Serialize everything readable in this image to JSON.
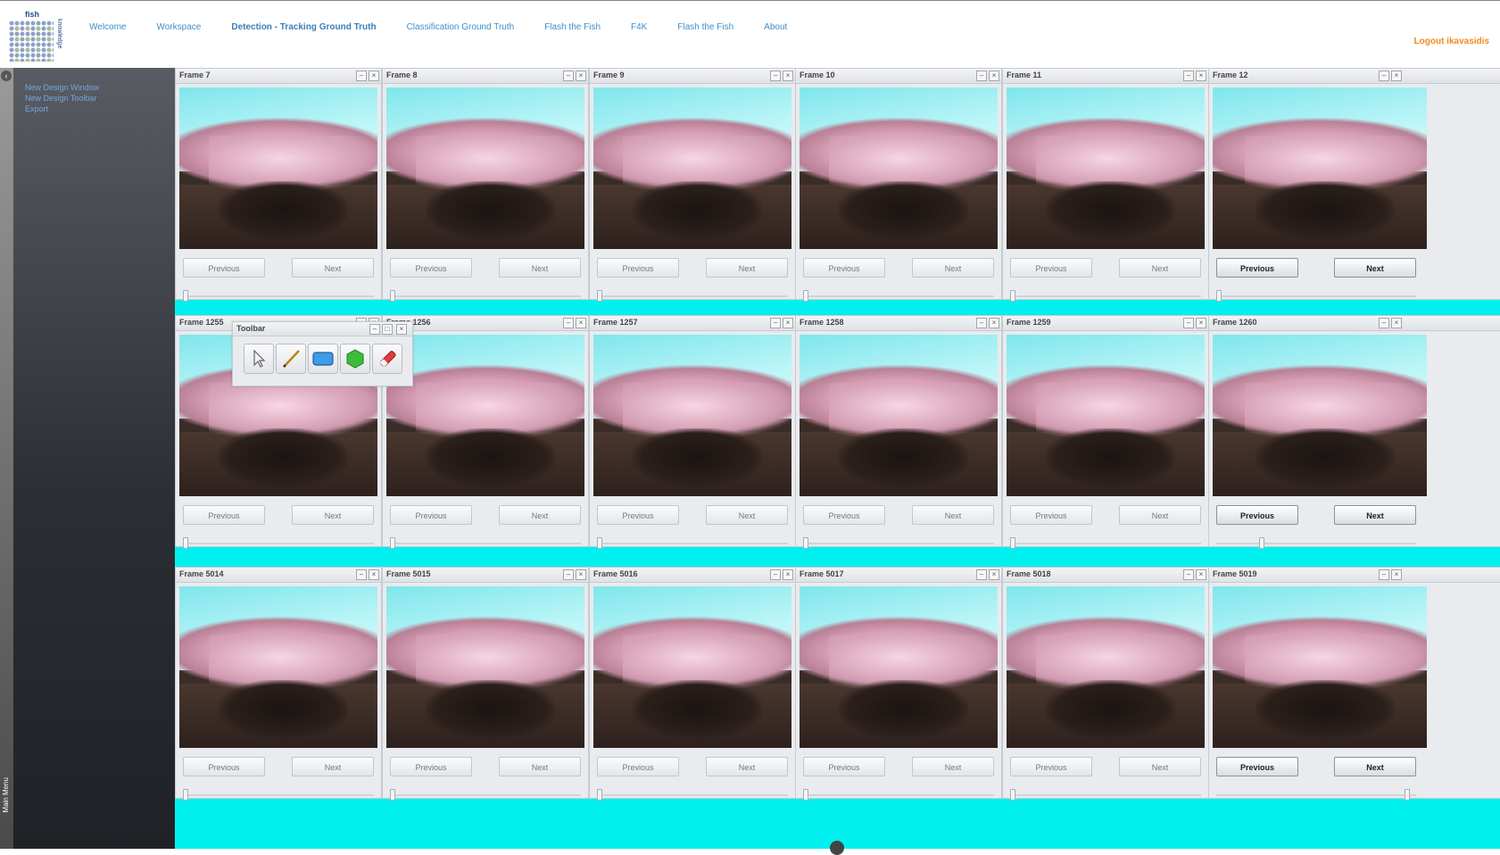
{
  "nav": {
    "items": [
      {
        "label": "Welcome",
        "active": false
      },
      {
        "label": "Workspace",
        "active": false
      },
      {
        "label": "Detection - Tracking Ground Truth",
        "active": true
      },
      {
        "label": "Classification Ground Truth",
        "active": false
      },
      {
        "label": "Flash the Fish",
        "active": false
      },
      {
        "label": "F4K",
        "active": false
      },
      {
        "label": "Flash the Fish",
        "active": false
      },
      {
        "label": "About",
        "active": false
      }
    ],
    "logout": "Logout ikavasidis"
  },
  "logo": {
    "text": "fish4knowledge",
    "top": "fish",
    "side": "knowledge"
  },
  "sidebar": {
    "strip_label": "Main Menu",
    "items": [
      "New Design Window",
      "New Design Toolbar",
      "Export"
    ]
  },
  "frames": {
    "titles": [
      "Frame 7",
      "Frame 8",
      "Frame 9",
      "Frame 10",
      "Frame 11",
      "Frame 12",
      "Frame 1255",
      "Frame 1256",
      "Frame 1257",
      "Frame 1258",
      "Frame 1259",
      "Frame 1260",
      "Frame 5014",
      "Frame 5015",
      "Frame 5016",
      "Frame 5017",
      "Frame 5018",
      "Frame 5019"
    ],
    "previous_label": "Previous",
    "next_label": "Next",
    "active_columns": [
      5
    ],
    "slider_levels": [
      0,
      0,
      0,
      0,
      0,
      0,
      0,
      0,
      0,
      0,
      0,
      0.22,
      0,
      0,
      0,
      0,
      0,
      0.97
    ]
  },
  "toolbar": {
    "title": "Toolbar",
    "tools": [
      "pointer-icon",
      "pencil-icon",
      "rectangle-icon",
      "polygon-icon",
      "eraser-icon"
    ]
  },
  "colors": {
    "workspace_bg": "#00f0f0",
    "nav_link": "#3f8fc8",
    "logout": "#ef8a1e"
  }
}
